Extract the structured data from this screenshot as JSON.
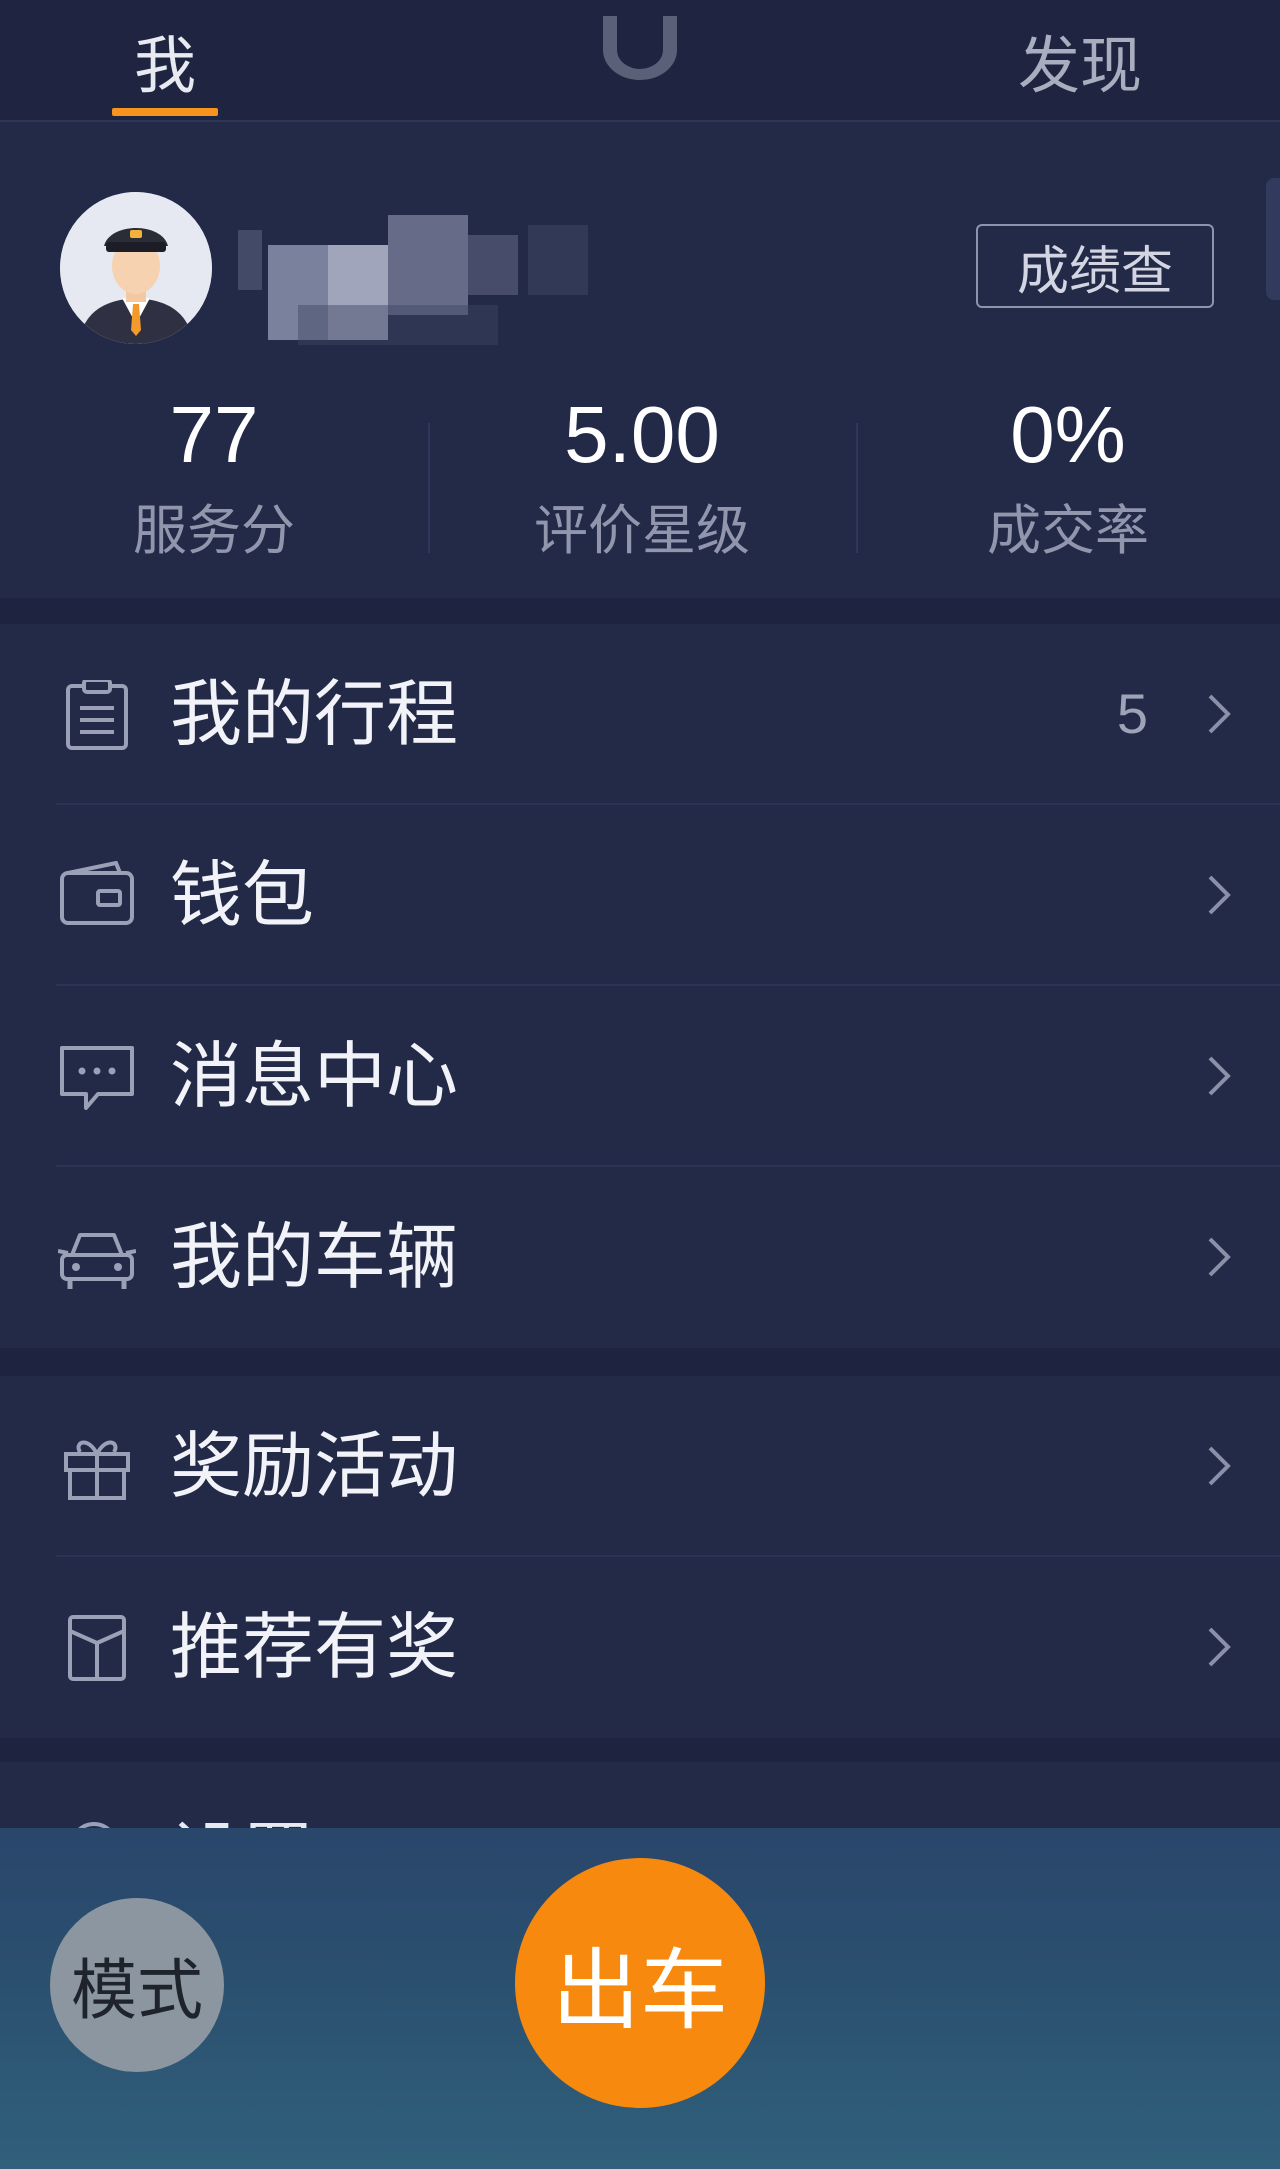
{
  "tabs": {
    "me": "我",
    "discover": "发现"
  },
  "profile": {
    "score_button": "成绩查",
    "stats": [
      {
        "value": "77",
        "label": "服务分"
      },
      {
        "value": "5.00",
        "label": "评价星级"
      },
      {
        "value": "0%",
        "label": "成交率"
      }
    ]
  },
  "menu": {
    "trips": {
      "label": "我的行程",
      "count": "5",
      "icon": "clipboard-icon"
    },
    "wallet": {
      "label": "钱包",
      "icon": "wallet-icon"
    },
    "messages": {
      "label": "消息中心",
      "icon": "chat-bubble-icon"
    },
    "vehicles": {
      "label": "我的车辆",
      "icon": "car-icon"
    },
    "rewards": {
      "label": "奖励活动",
      "icon": "gift-icon"
    },
    "referral": {
      "label": "推荐有奖",
      "icon": "box-icon"
    },
    "settings": {
      "label": "设置",
      "icon": "gear-icon"
    }
  },
  "bottom": {
    "mode_button": "模式",
    "go_button": "出车"
  },
  "colors": {
    "background": "#232a48",
    "accent": "#f7941d",
    "go_button": "#f7890f",
    "mode_button": "#8b96a0"
  }
}
